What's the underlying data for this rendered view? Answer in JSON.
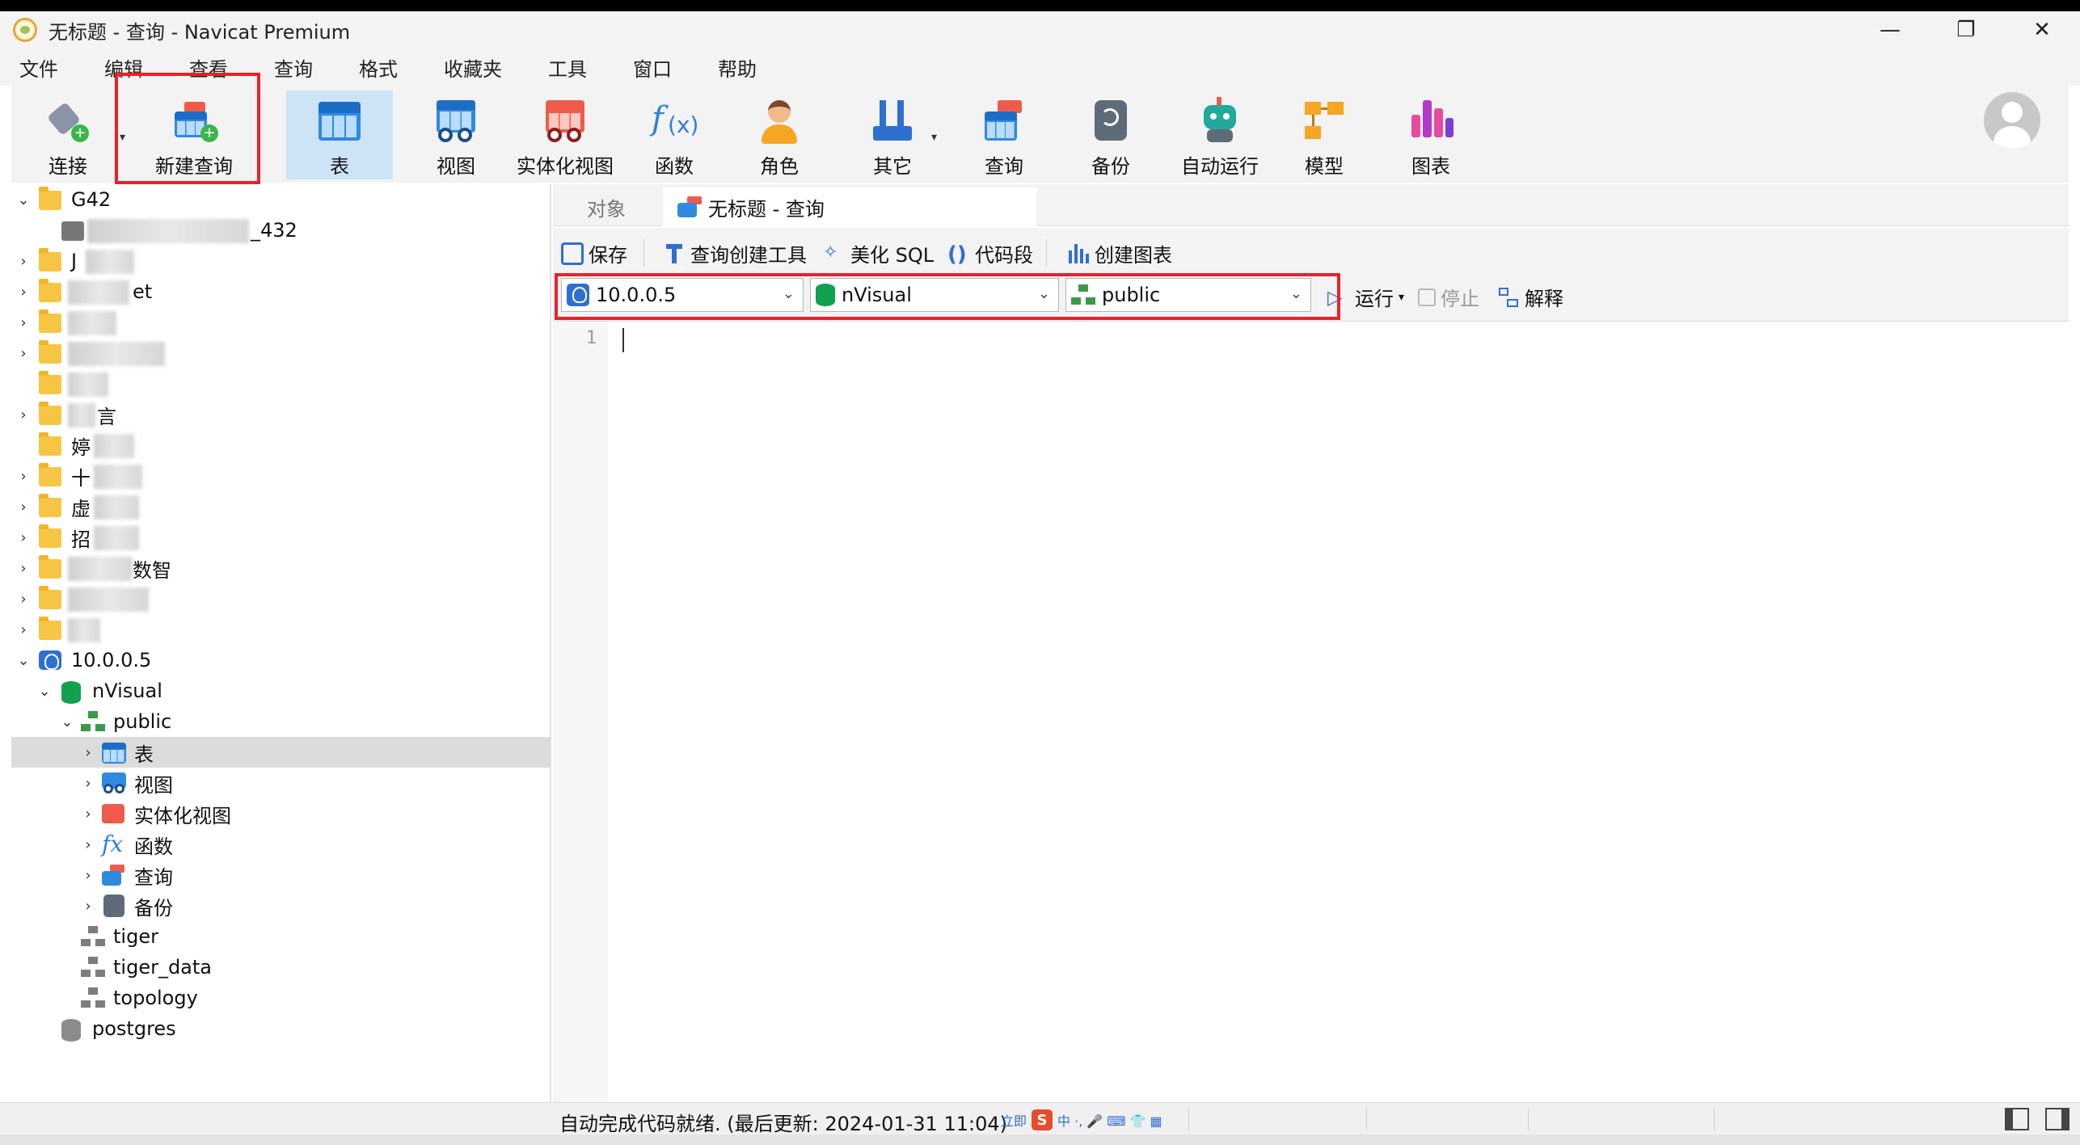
{
  "window": {
    "title": "无标题 - 查询 - Navicat Premium",
    "controls": {
      "minimize": "—",
      "restore": "❐",
      "close": "✕"
    }
  },
  "menu": [
    "文件",
    "编辑",
    "查看",
    "查询",
    "格式",
    "收藏夹",
    "工具",
    "窗口",
    "帮助"
  ],
  "toolbar": [
    {
      "id": "connect",
      "label": "连接",
      "icon": "plug-icon"
    },
    {
      "id": "new-query",
      "label": "新建查询",
      "icon": "new-query-icon"
    },
    {
      "id": "table",
      "label": "表",
      "icon": "table-icon"
    },
    {
      "id": "view",
      "label": "视图",
      "icon": "view-icon"
    },
    {
      "id": "mview",
      "label": "实体化视图",
      "icon": "materialized-view-icon"
    },
    {
      "id": "function",
      "label": "函数",
      "icon": "function-icon"
    },
    {
      "id": "role",
      "label": "角色",
      "icon": "user-icon"
    },
    {
      "id": "other",
      "label": "其它",
      "icon": "tools-icon"
    },
    {
      "id": "query",
      "label": "查询",
      "icon": "query-icon"
    },
    {
      "id": "backup",
      "label": "备份",
      "icon": "backup-icon"
    },
    {
      "id": "autorun",
      "label": "自动运行",
      "icon": "robot-icon"
    },
    {
      "id": "model",
      "label": "模型",
      "icon": "model-icon"
    },
    {
      "id": "chart",
      "label": "图表",
      "icon": "chart-icon"
    }
  ],
  "tree": {
    "conn1": "G42",
    "conn1_child": "_432",
    "folders": [
      "J",
      "et",
      "",
      "",
      "",
      "言",
      "婷",
      "十",
      "虚",
      "招",
      "数智",
      "",
      ""
    ],
    "pg_conn": "10.0.0.5",
    "database": "nVisual",
    "schema": "public",
    "schema_items": [
      "表",
      "视图",
      "实体化视图",
      "函数",
      "查询",
      "备份"
    ],
    "other_schemas": [
      "tiger",
      "tiger_data",
      "topology"
    ],
    "other_db": "postgres"
  },
  "tabs": {
    "objects": "对象",
    "query": "无标题 - 查询"
  },
  "query_toolbar": {
    "save": "保存",
    "builder": "查询创建工具",
    "beautify": "美化 SQL",
    "snippet": "代码段",
    "create_chart": "创建图表",
    "run": "运行",
    "stop": "停止",
    "explain": "解释"
  },
  "selectors": {
    "connection": "10.0.0.5",
    "database": "nVisual",
    "schema": "public"
  },
  "editor": {
    "line_number": "1"
  },
  "status": {
    "text": "自动完成代码就绪. (最后更新: 2024-01-31 11:04)",
    "ime_prefix": "立即",
    "ime_logo": "S",
    "ime_icons": "中 ·, 🎤 ⌨ 👕 ▦"
  }
}
